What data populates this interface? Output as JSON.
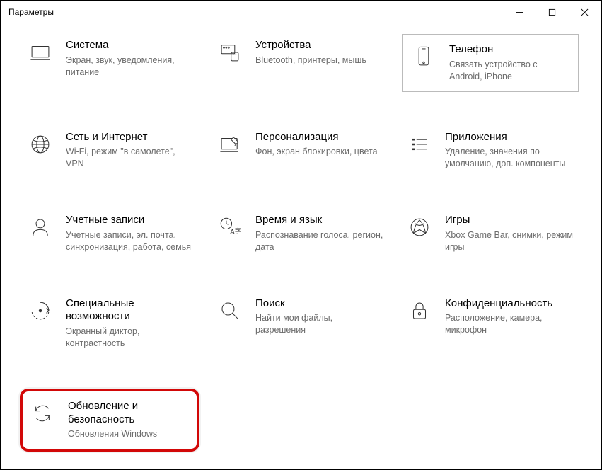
{
  "window": {
    "title": "Параметры"
  },
  "tiles": {
    "system": {
      "title": "Система",
      "desc": "Экран, звук, уведомления, питание"
    },
    "devices": {
      "title": "Устройства",
      "desc": "Bluetooth, принтеры, мышь"
    },
    "phone": {
      "title": "Телефон",
      "desc": "Связать устройство с Android, iPhone"
    },
    "network": {
      "title": "Сеть и Интернет",
      "desc": "Wi-Fi, режим \"в самолете\", VPN"
    },
    "personalize": {
      "title": "Персонализация",
      "desc": "Фон, экран блокировки, цвета"
    },
    "apps": {
      "title": "Приложения",
      "desc": "Удаление, значения по умолчанию, доп. компоненты"
    },
    "accounts": {
      "title": "Учетные записи",
      "desc": "Учетные записи, эл. почта, синхронизация, работа, семья"
    },
    "time": {
      "title": "Время и язык",
      "desc": "Распознавание голоса, регион, дата"
    },
    "gaming": {
      "title": "Игры",
      "desc": "Xbox Game Bar, снимки, режим игры"
    },
    "ease": {
      "title": "Специальные возможности",
      "desc": "Экранный диктор, контрастность"
    },
    "search": {
      "title": "Поиск",
      "desc": "Найти мои файлы, разрешения"
    },
    "privacy": {
      "title": "Конфиденциальность",
      "desc": "Расположение, камера, микрофон"
    },
    "update": {
      "title": "Обновление и безопасность",
      "desc": "Обновления Windows"
    }
  }
}
